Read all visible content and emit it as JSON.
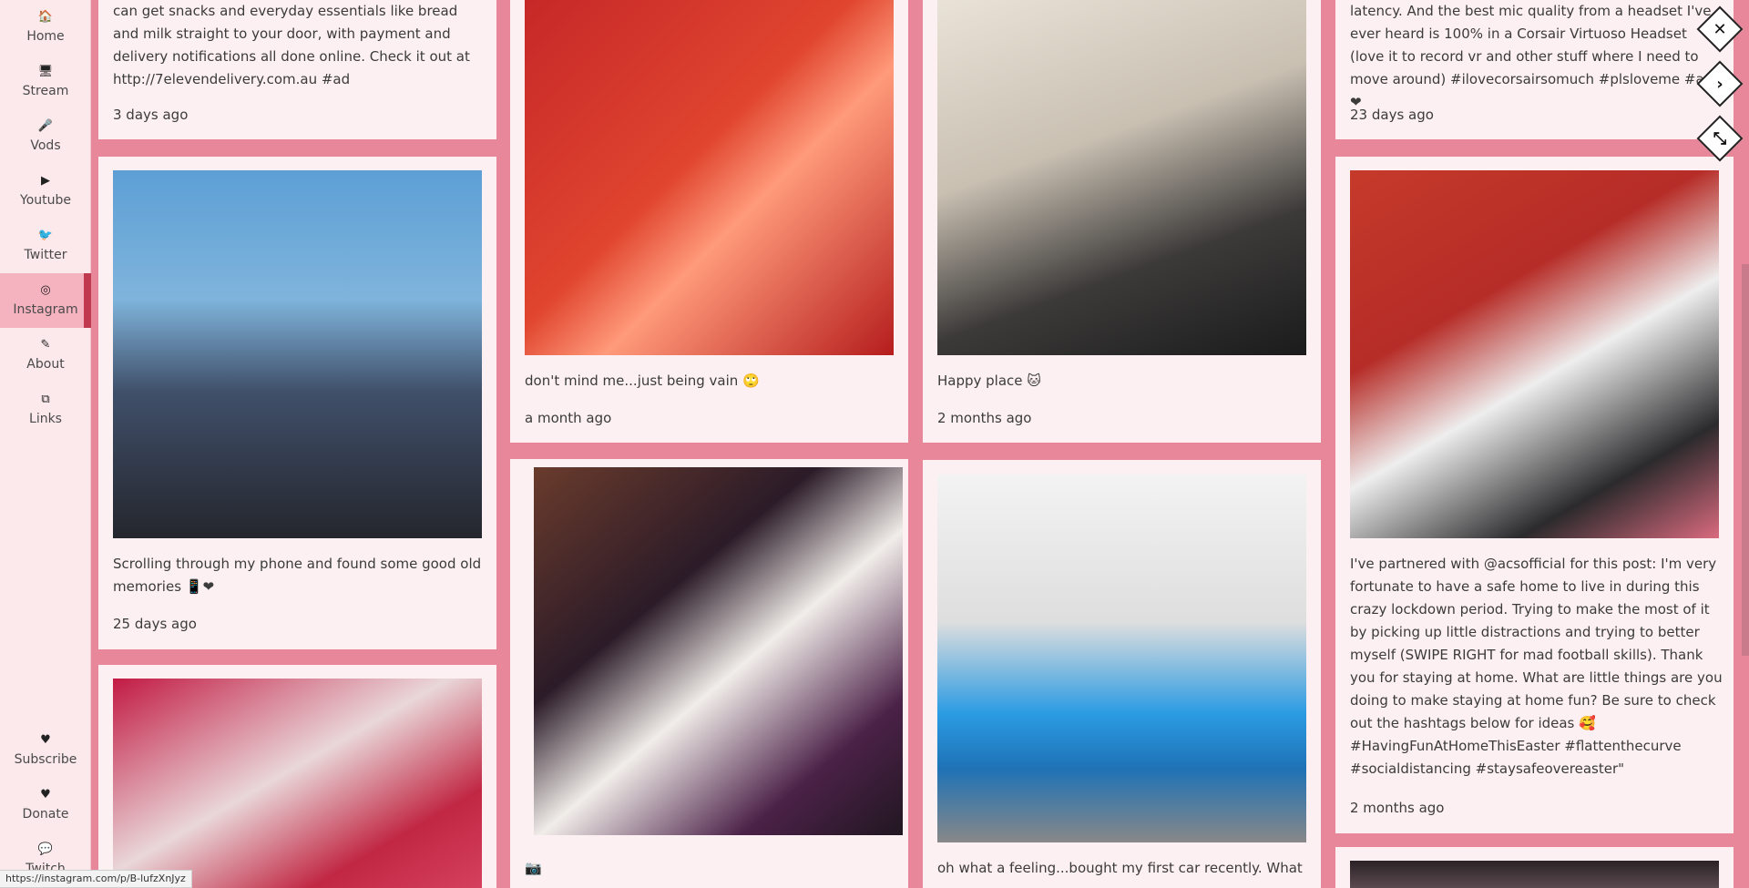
{
  "sidebar": {
    "items": [
      {
        "label": "Home",
        "icon": "home-icon",
        "glyph": "🏠"
      },
      {
        "label": "Stream",
        "icon": "monitor-icon",
        "glyph": "🖥"
      },
      {
        "label": "Vods",
        "icon": "microphone-icon",
        "glyph": "🎤"
      },
      {
        "label": "Youtube",
        "icon": "youtube-icon",
        "glyph": "▶"
      },
      {
        "label": "Twitter",
        "icon": "twitter-icon",
        "glyph": "🐦"
      },
      {
        "label": "Instagram",
        "icon": "instagram-icon",
        "glyph": "◎"
      },
      {
        "label": "About",
        "icon": "edit-icon",
        "glyph": "✎"
      },
      {
        "label": "Links",
        "icon": "external-link-icon",
        "glyph": "⧉"
      }
    ],
    "bottom": [
      {
        "label": "Subscribe",
        "icon": "heart-broken-icon",
        "glyph": "♥"
      },
      {
        "label": "Donate",
        "icon": "heart-icon",
        "glyph": "♥"
      },
      {
        "label": "Twitch",
        "icon": "chat-icon",
        "glyph": "💬"
      }
    ]
  },
  "status_url": "https://instagram.com/p/B-lufzXnJyz",
  "posts": {
    "c1p1": {
      "caption": "can get snacks and everyday essentials like bread and milk straight to your door, with payment and delivery notifications all done online. Check it out at http://7elevendelivery.com.au #ad",
      "time": "3 days ago"
    },
    "c1p2": {
      "caption": "Scrolling through my phone and found some good old memories 📱❤",
      "time": "25 days ago"
    },
    "c2p1": {
      "caption": "don't mind me...just being vain 🙄",
      "time": "a month ago"
    },
    "c2p2": {
      "caption": "📷",
      "time": ""
    },
    "c3p1": {
      "caption": "Happy place 🐱",
      "time": "2 months ago"
    },
    "c3p2": {
      "caption": "oh what a feeling...bought my first car recently. What",
      "time": ""
    },
    "c4p1": {
      "caption": "latency. And the best mic quality from a headset I've ever heard is 100% in a Corsair Virtuoso Headset (love it to record vr and other stuff where I need to move around) #ilovecorsairsomuch #plsloveme #ad ❤",
      "time": "23 days ago"
    },
    "c4p2": {
      "caption": "I've partnered with @acsofficial for this post: I'm very fortunate to have a safe home to live in during this crazy lockdown period. Trying to make the most of it by picking up little distractions and trying to better myself (SWIPE RIGHT for mad football skills). Thank you for staying at home. What are little things are you doing to make staying at home fun? Be sure to check out the hashtags below for ideas 🥰 #HavingFunAtHomeThisEaster #flattenthecurve #socialdistancing #staysafeovereaster\"",
      "time": "2 months ago"
    }
  },
  "controls": {
    "close": "✕",
    "next": "›",
    "collapse": "⤡"
  },
  "colors": {
    "background": "#e9879a",
    "card": "#fdf0f2",
    "sidebar": "#fce9ec",
    "accent": "#c0394f"
  }
}
